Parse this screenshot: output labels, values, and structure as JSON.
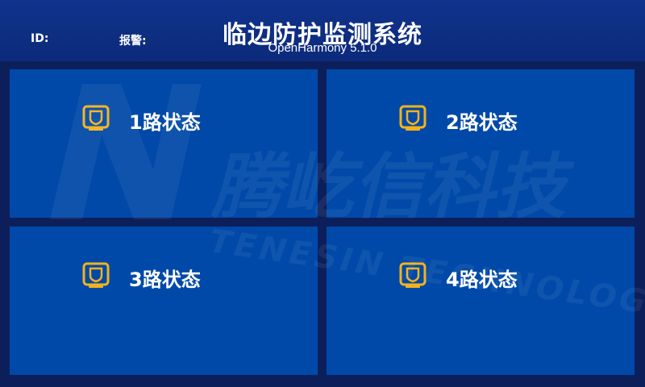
{
  "header": {
    "id_label": "ID:",
    "alarm_label": "报警:",
    "title": "临边防护监测系统",
    "subtitle": "OpenHarmony 5.1.0"
  },
  "channels": [
    {
      "label": "1路状态"
    },
    {
      "label": "2路状态"
    },
    {
      "label": "3路状态"
    },
    {
      "label": "4路状态"
    }
  ],
  "watermark": {
    "brand_cn": "腾屹信科技",
    "brand_en": "TENESIN TECHNOLOGY"
  },
  "colors": {
    "background": "#0c1f5a",
    "header": "#10338c",
    "panel": "#0049a8",
    "icon_accent": "#f3b21b",
    "text": "#ffffff"
  },
  "icons": {
    "channel_status": "shield-monitor-icon"
  }
}
